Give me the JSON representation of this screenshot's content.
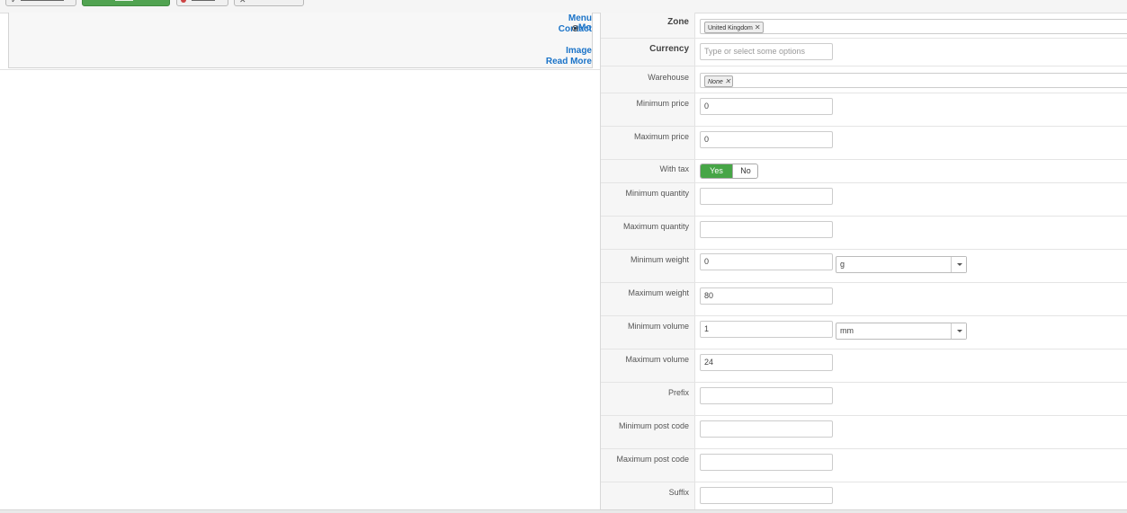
{
  "left_panel": {
    "links": [
      "Menu",
      "Contact",
      "Image",
      "Read More"
    ],
    "radio_label": "Mo"
  },
  "form": {
    "zone": {
      "label": "Zone",
      "tag": "United Kingdom"
    },
    "currency": {
      "label": "Currency",
      "placeholder": "Type or select some options"
    },
    "warehouse": {
      "label": "Warehouse",
      "tag": "None"
    },
    "min_price": {
      "label": "Minimum price",
      "value": "0"
    },
    "max_price": {
      "label": "Maximum price",
      "value": "0"
    },
    "with_tax": {
      "label": "With tax",
      "yes": "Yes",
      "no": "No",
      "selected": "Yes"
    },
    "min_qty": {
      "label": "Minimum quantity",
      "value": ""
    },
    "max_qty": {
      "label": "Maximum quantity",
      "value": ""
    },
    "min_weight": {
      "label": "Minimum weight",
      "value": "0",
      "unit": "g"
    },
    "max_weight": {
      "label": "Maximum weight",
      "value": "80"
    },
    "min_volume": {
      "label": "Minimum volume",
      "value": "1",
      "unit": "mm"
    },
    "max_volume": {
      "label": "Maximum volume",
      "value": "24"
    },
    "prefix": {
      "label": "Prefix",
      "value": ""
    },
    "min_postcode": {
      "label": "Minimum post code",
      "value": ""
    },
    "max_postcode": {
      "label": "Maximum post code",
      "value": ""
    },
    "suffix": {
      "label": "Suffix",
      "value": ""
    }
  },
  "colors": {
    "accent_green": "#46a546",
    "link_blue": "#1a73c8"
  }
}
